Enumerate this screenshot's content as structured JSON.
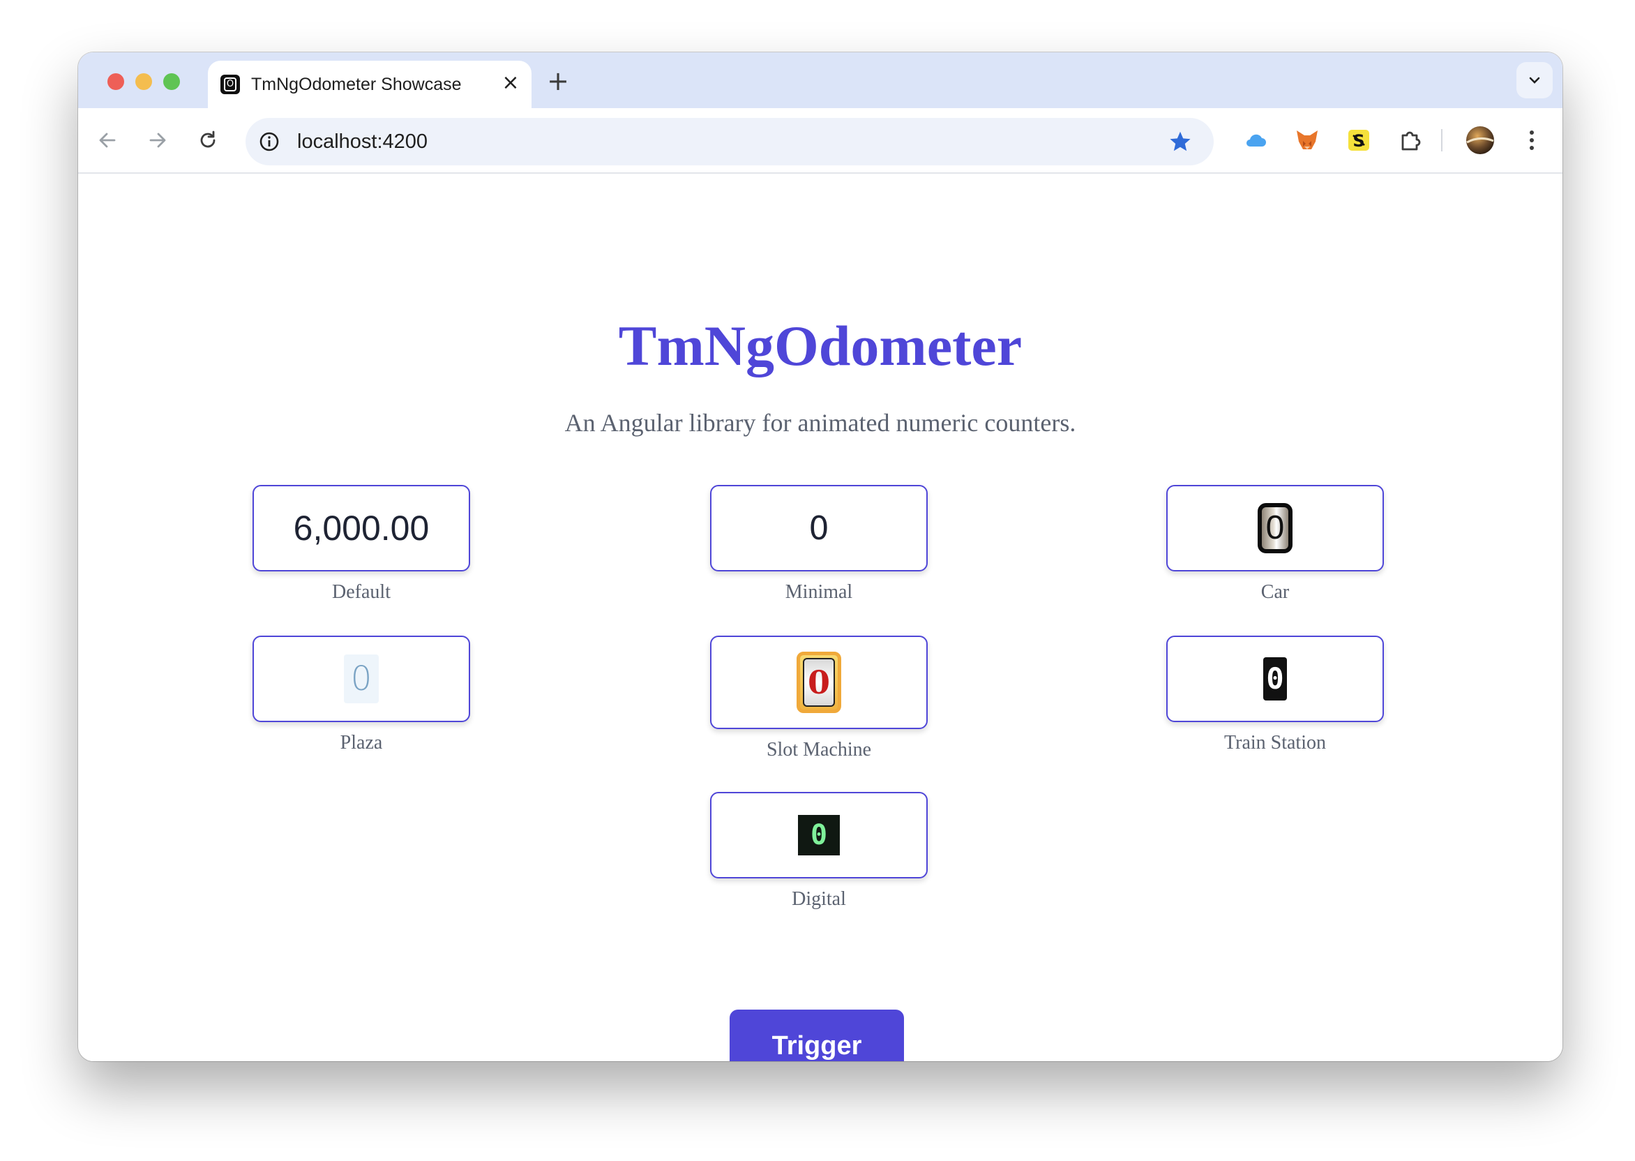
{
  "browser": {
    "tab": {
      "title": "TmNgOdometer Showcase",
      "favicon_glyph": "O",
      "close_icon": "×"
    },
    "new_tab_icon": "+",
    "address_bar": {
      "url": "localhost:4200"
    },
    "extensions": [
      "cloud-icon",
      "fox-icon",
      "s-badge-icon",
      "puzzle-icon",
      "avatar",
      "kebab-menu-icon"
    ]
  },
  "page": {
    "title": "TmNgOdometer",
    "subtitle": "An Angular library for animated numeric counters.",
    "odometers": [
      {
        "label": "Default",
        "value": "6,000.00"
      },
      {
        "label": "Minimal",
        "value": "0"
      },
      {
        "label": "Car",
        "value": "0"
      },
      {
        "label": "Plaza",
        "value": "0"
      },
      {
        "label": "Slot Machine",
        "value": "0"
      },
      {
        "label": "Train Station",
        "value": "0"
      },
      {
        "label": "Digital",
        "value": "0"
      }
    ],
    "trigger_label": "Trigger"
  },
  "colors": {
    "accent": "#4f46d8",
    "caption": "#5b6270",
    "tabstrip": "#dbe4f8"
  }
}
